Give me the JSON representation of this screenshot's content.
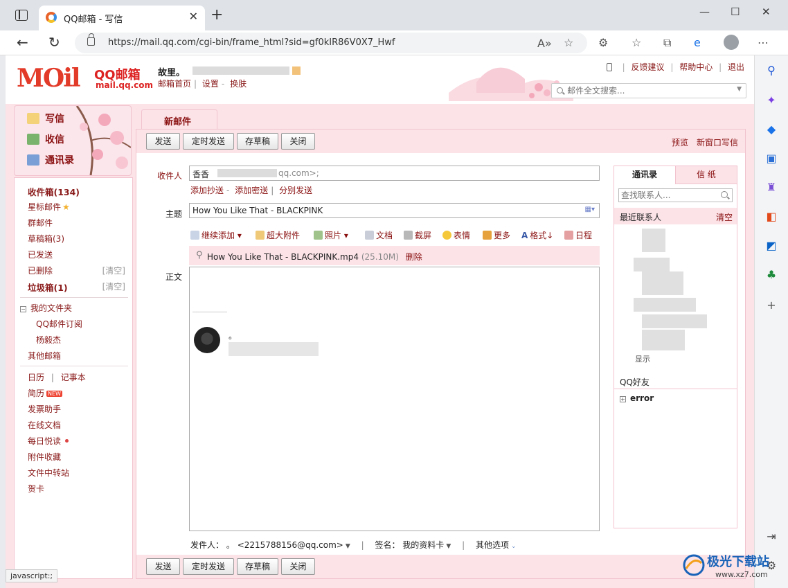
{
  "browser": {
    "tab_title": "QQ邮箱 - 写信",
    "url": "https://mail.qq.com/cgi-bin/frame_html?sid=gf0kIR86V0X7_Hwf",
    "status_tip": "javascript:;"
  },
  "header": {
    "logo_text": "MOil",
    "product_name": "QQ邮箱",
    "domain": "mail.qq.com",
    "user_name": "故里。",
    "links": [
      "邮箱首页",
      "设置",
      "换肤"
    ],
    "top_links": [
      "反馈建议",
      "帮助中心",
      "退出"
    ],
    "search_placeholder": "邮件全文搜索..."
  },
  "left_actions": [
    {
      "label": "写信",
      "icon": "pencil-icon"
    },
    {
      "label": "收信",
      "icon": "inbox-download-icon"
    },
    {
      "label": "通讯录",
      "icon": "addressbook-icon"
    }
  ],
  "left_nav": {
    "inbox": "收件箱(134)",
    "starred": "星标邮件",
    "group": "群邮件",
    "drafts": "草稿箱(3)",
    "sent": "已发送",
    "deleted": "已删除",
    "deleted_clear": "[清空]",
    "spam": "垃圾箱(1)",
    "spam_clear": "[清空]",
    "my_folders": "我的文件夹",
    "folder_subscription": "QQ邮件订阅",
    "folder_person": "杨毅杰",
    "other_mailboxes": "其他邮箱",
    "calendar": "日历",
    "notebook": "记事本",
    "resume": "简历",
    "new_badge": "NEW",
    "invoice": "发票助手",
    "online_docs": "在线文档",
    "daily_reading": "每日悦读",
    "attachments": "附件收藏",
    "file_transfer": "文件中转站",
    "greeting_card": "贺卡"
  },
  "compose": {
    "tab_label": "新邮件",
    "buttons": {
      "send": "发送",
      "scheduled_send": "定时发送",
      "save_draft": "存草稿",
      "close": "关闭"
    },
    "preview": "预览",
    "new_window": "新窗口写信",
    "to_label": "收件人",
    "to_value": "香香",
    "to_suffix": "qq.com>;",
    "add_cc": "添加抄送",
    "add_bcc": "添加密送",
    "separate_send": "分别发送",
    "subject_label": "主题",
    "subject_value": "How You Like That - BLACKPINK",
    "tools": {
      "continue_add": "继续添加",
      "big_attachment": "超大附件",
      "photo": "照片",
      "document": "文档",
      "screenshot": "截屏",
      "emoji": "表情",
      "more": "更多",
      "format": "格式↓",
      "schedule": "日程"
    },
    "attachment_name": "How You Like That - BLACKPINK.mp4",
    "attachment_size": "(25.10M)",
    "attachment_delete": "删除",
    "body_label": "正文",
    "signature_dot": "。",
    "sender_label": "发件人：",
    "sender_name": "。",
    "sender_email": "<2215788156@qq.com>",
    "signature_label": "签名：",
    "signature_value": "我的资料卡",
    "other_options": "其他选项"
  },
  "contacts": {
    "tab_contacts": "通讯录",
    "tab_stationery": "信 纸",
    "search_placeholder": "查找联系人...",
    "recent": "最近联系人",
    "clear": "清空",
    "show_partial": "显示",
    "qq_friends": "QQ好友",
    "group_error": "error"
  },
  "watermark": {
    "brand": "极光下载站",
    "url": "www.xz7.com"
  },
  "colors": {
    "accent": "#8a1010",
    "pink_bg": "#fbe3e8",
    "pink_border": "#f2c3cf",
    "logo_red": "#e33b2a"
  }
}
